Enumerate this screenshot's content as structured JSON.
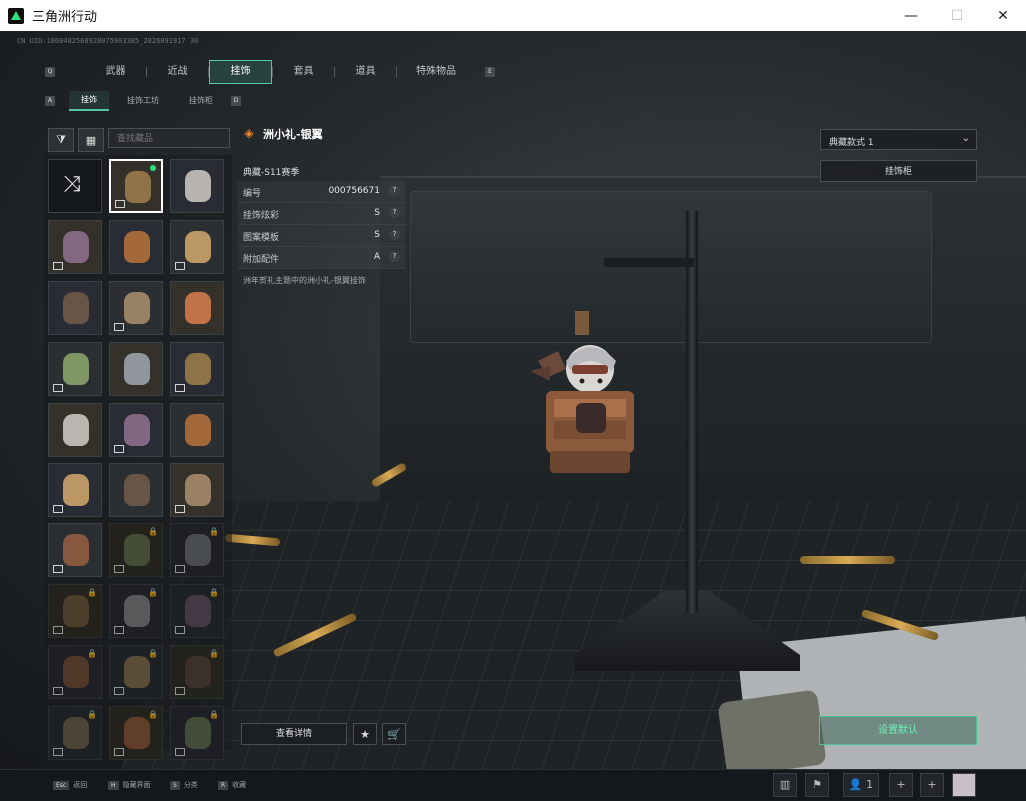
{
  "window": {
    "title": "三角洲行动",
    "minimize": "—",
    "maximize": "☐",
    "close": "✕"
  },
  "uid_line": "CN UID:1800482568928075903385_2026091917 30",
  "tabs": {
    "left_key": "Q",
    "right_key": "E",
    "items": [
      "武器",
      "近战",
      "挂饰",
      "套具",
      "道具",
      "特殊物品"
    ],
    "selected": "挂饰"
  },
  "subtabs": {
    "left_key": "A",
    "right_key": "D",
    "items": [
      "挂饰",
      "挂饰工坊",
      "挂饰柜"
    ],
    "selected": "挂饰"
  },
  "search": {
    "placeholder": "查找藏品"
  },
  "detail": {
    "title": "洲小礼-银翼",
    "season": "典藏-S11赛季",
    "attributes": [
      {
        "key": "编号",
        "value": "000756671"
      },
      {
        "key": "挂饰炫彩",
        "value": "S"
      },
      {
        "key": "图案模板",
        "value": "S"
      },
      {
        "key": "附加配件",
        "value": "A"
      }
    ],
    "description": "洲年贺礼主题中的洲小礼-银翼挂饰"
  },
  "right_panel": {
    "style_select": "典藏款式 1",
    "cabinet_button": "挂饰柜"
  },
  "actions": {
    "view_details": "查看详情",
    "set_default": "设置默认"
  },
  "bottom_hints": [
    {
      "key": "Esc",
      "label": "返回"
    },
    {
      "key": "H",
      "label": "隐藏界面"
    },
    {
      "key": "S",
      "label": "分类"
    },
    {
      "key": "R",
      "label": "收藏"
    }
  ],
  "bottom_right": {
    "friends_count": "1"
  },
  "colors": {
    "accent": "#54c5a8",
    "green": "#2ee07e"
  }
}
